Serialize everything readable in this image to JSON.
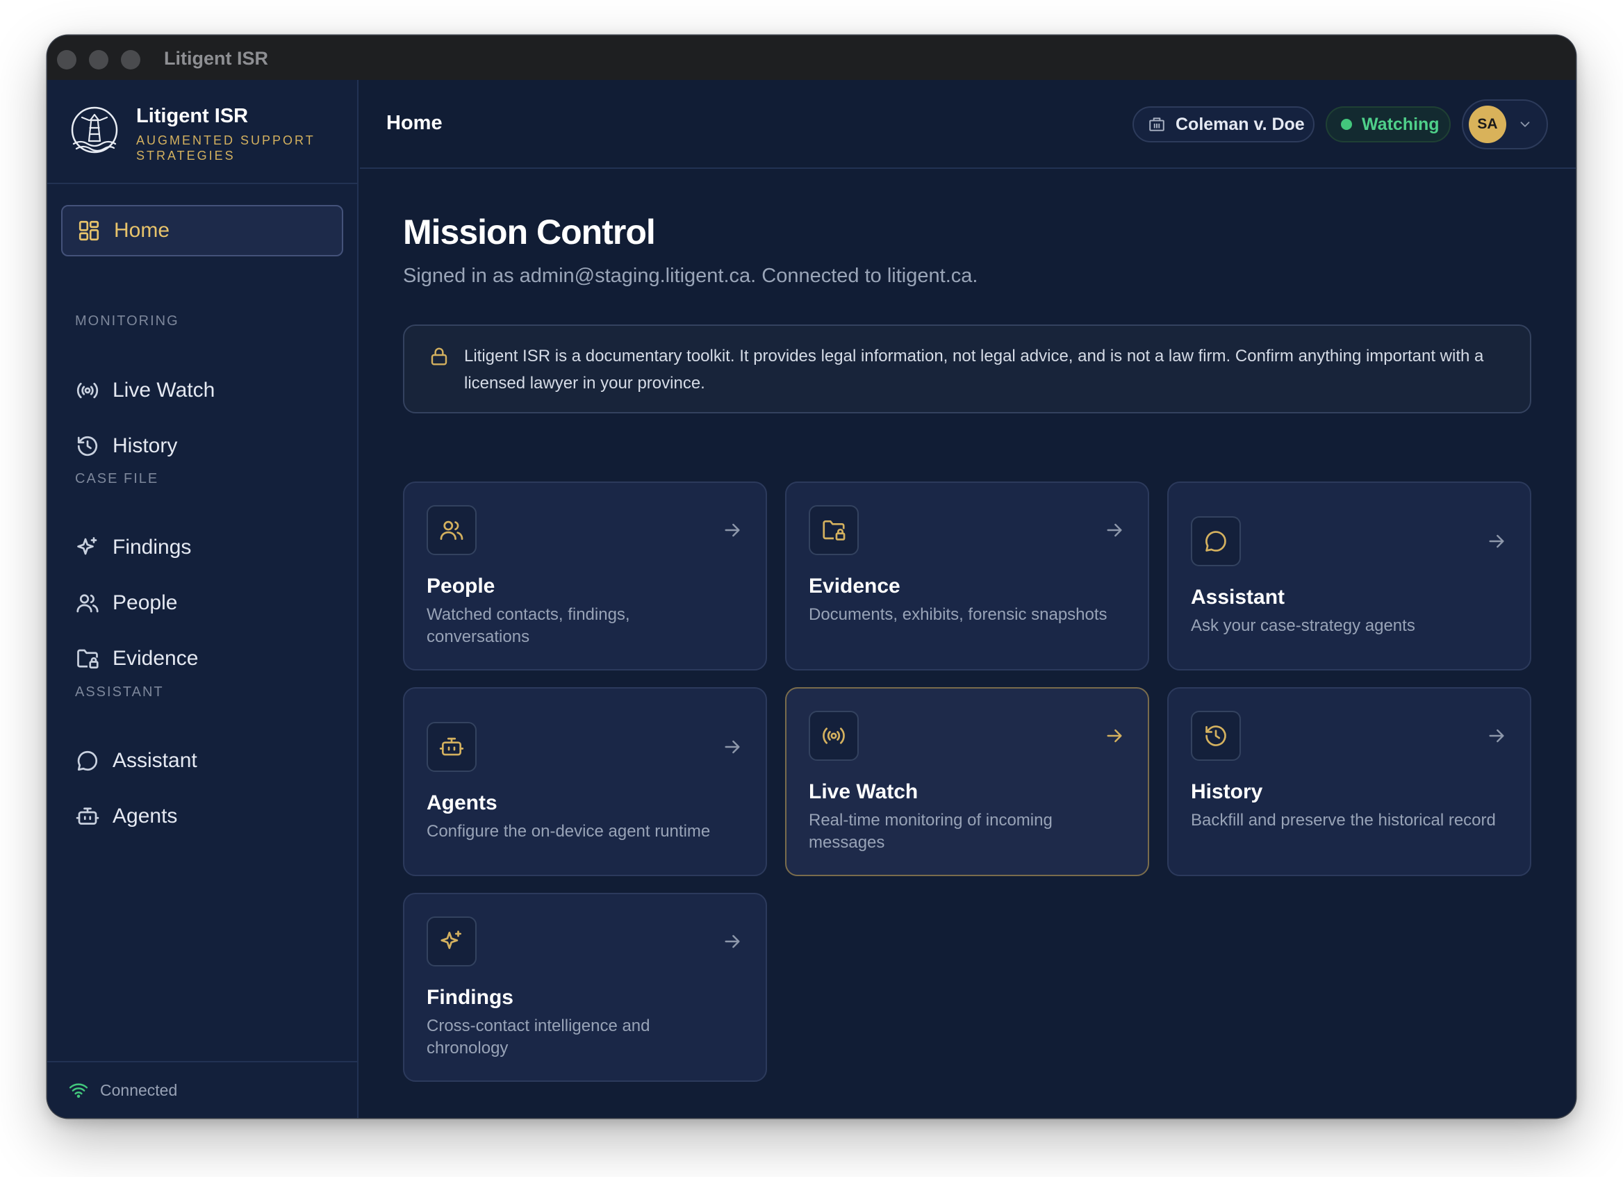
{
  "window": {
    "title": "Litigent ISR"
  },
  "brand": {
    "name": "Litigent ISR",
    "tagline": "AUGMENTED SUPPORT STRATEGIES"
  },
  "sidebar": {
    "home": {
      "label": "Home",
      "icon": "grid-icon"
    },
    "sections": {
      "monitoring": "MONITORING",
      "case_file": "CASE FILE",
      "assistant": "ASSISTANT"
    },
    "items": [
      {
        "label": "Live Watch",
        "icon": "broadcast-icon"
      },
      {
        "label": "History",
        "icon": "history-icon"
      },
      {
        "label": "Findings",
        "icon": "sparkles-icon"
      },
      {
        "label": "People",
        "icon": "people-icon"
      },
      {
        "label": "Evidence",
        "icon": "folder-lock-icon"
      },
      {
        "label": "Assistant",
        "icon": "chat-icon"
      },
      {
        "label": "Agents",
        "icon": "robot-icon"
      }
    ],
    "footer": {
      "status": "Connected"
    }
  },
  "header": {
    "title": "Home",
    "case_label": "Coleman v. Doe",
    "watch_status": "Watching",
    "user_initials": "SA"
  },
  "main": {
    "title": "Mission Control",
    "subtitle": "Signed in as admin@staging.litigent.ca. Connected to litigent.ca.",
    "notice": "Litigent ISR is a documentary toolkit. It provides legal information, not legal advice, and is not a law firm. Confirm anything important with a licensed lawyer in your province.",
    "cards": [
      {
        "title": "People",
        "desc": "Watched contacts, findings, conversations",
        "icon": "people-icon"
      },
      {
        "title": "Evidence",
        "desc": "Documents, exhibits, forensic snapshots",
        "icon": "folder-lock-icon"
      },
      {
        "title": "Assistant",
        "desc": "Ask your case-strategy agents",
        "icon": "chat-icon"
      },
      {
        "title": "Agents",
        "desc": "Configure the on-device agent runtime",
        "icon": "robot-icon"
      },
      {
        "title": "Live Watch",
        "desc": "Real-time monitoring of incoming messages",
        "icon": "broadcast-icon"
      },
      {
        "title": "History",
        "desc": "Backfill and preserve the historical record",
        "icon": "history-icon"
      },
      {
        "title": "Findings",
        "desc": "Cross-contact intelligence and chronology",
        "icon": "sparkles-icon"
      }
    ]
  },
  "colors": {
    "accent_gold": "#d4b15f",
    "status_green": "#43c77c",
    "background": "#111d35",
    "card": "#1a2747"
  }
}
